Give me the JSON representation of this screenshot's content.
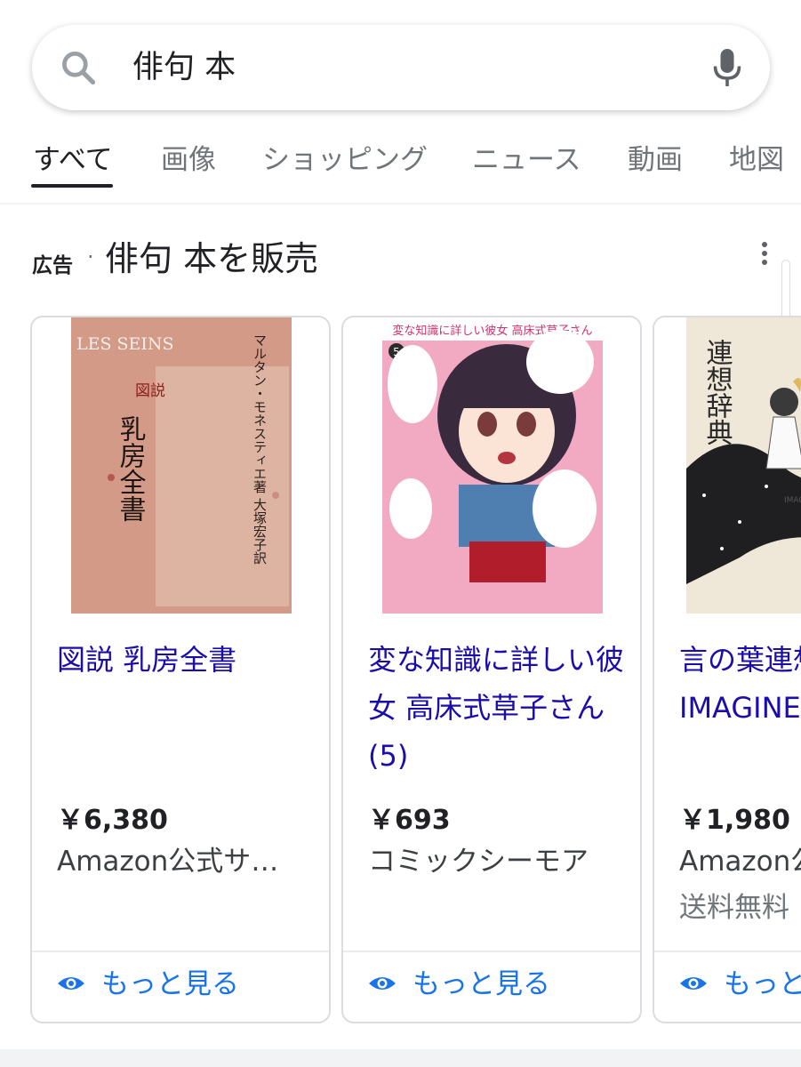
{
  "search": {
    "query": "俳句 本"
  },
  "tabs": [
    {
      "label": "すべて",
      "active": true
    },
    {
      "label": "画像",
      "active": false
    },
    {
      "label": "ショッピング",
      "active": false
    },
    {
      "label": "ニュース",
      "active": false
    },
    {
      "label": "動画",
      "active": false
    },
    {
      "label": "地図",
      "active": false
    }
  ],
  "ad": {
    "label": "広告",
    "separator": "·",
    "title": "俳句 本を販売"
  },
  "products": [
    {
      "title": "図説 乳房全書",
      "price": "￥6,380",
      "seller": "Amazon公式サ…",
      "shipping": "",
      "more_label": "もっと見る",
      "cover": {
        "top_text": "LES SEINS",
        "main_text": "乳房全書",
        "sub_text": "図説",
        "author": "マルタン・モネスティエ著 大塚宏子訳"
      }
    },
    {
      "title": "変な知識に詳しい彼女 高床式草子さん(5)",
      "price": "￥693",
      "seller": "コミックシーモア",
      "shipping": "",
      "more_label": "もっと見る",
      "cover": {
        "top_text": "変な知識に詳しい彼女 高床式草子さん",
        "volume": "5"
      }
    },
    {
      "title": "言の葉連想辞典 (YUEISHA IMAGINE DICTIONARY)",
      "price": "￥1,980",
      "seller": "Amazon公式サ…",
      "shipping": "送料無料",
      "more_label": "もっと見る",
      "cover": {
        "main_text": "連想辞典",
        "sub_text": "IMAGINE D"
      }
    }
  ],
  "colors": {
    "link": "#1a0dab",
    "accent": "#1a73e8",
    "border": "#dadce0"
  }
}
